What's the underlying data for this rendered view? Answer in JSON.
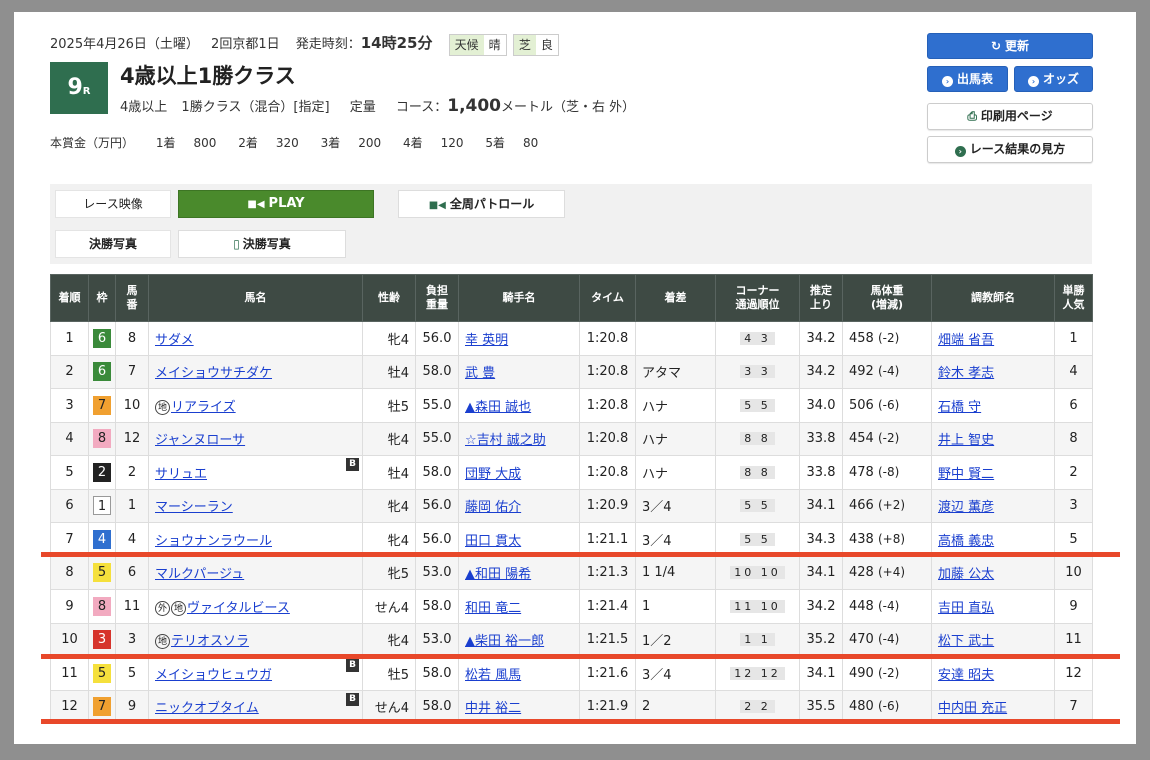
{
  "race": {
    "date": "2025年4月26日（土曜）",
    "meeting": "2回京都1日",
    "start_label": "発走時刻：",
    "start_time": "14時25分",
    "weather_label": "天候",
    "weather": "晴",
    "track_label": "芝",
    "track_cond": "良",
    "number": "9",
    "number_suffix": "R",
    "name": "4歳以上1勝クラス",
    "cond1": "4歳以上",
    "cond2": "1勝クラス（混合）[指定]",
    "cond3": "定量",
    "course_label": "コース：",
    "distance": "1,400",
    "course_detail": "メートル（芝・右 外）",
    "prize_label": "本賞金（万円）",
    "prizes": [
      {
        "place": "1着",
        "amount": "800"
      },
      {
        "place": "2着",
        "amount": "320"
      },
      {
        "place": "3着",
        "amount": "200"
      },
      {
        "place": "4着",
        "amount": "120"
      },
      {
        "place": "5着",
        "amount": "80"
      }
    ]
  },
  "buttons": {
    "update": "更新",
    "entries": "出馬表",
    "odds": "オッズ",
    "print": "印刷用ページ",
    "howto": "レース結果の見方"
  },
  "video": {
    "label": "レース映像",
    "play": "PLAY",
    "patrol": "全周パトロール",
    "photo_label": "決勝写真",
    "photo_btn": "決勝写真"
  },
  "headers": {
    "place": "着順",
    "waku": "枠",
    "num_1": "馬",
    "num_2": "番",
    "horse": "馬名",
    "sexage": "性齢",
    "weight_1": "負担",
    "weight_2": "重量",
    "jockey": "騎手名",
    "time": "タイム",
    "margin": "着差",
    "corner_1": "コーナー",
    "corner_2": "通過順位",
    "last_1": "推定",
    "last_2": "上り",
    "bw_1": "馬体重",
    "bw_2": "(増減)",
    "trainer": "調教師名",
    "pop_1": "単勝",
    "pop_2": "人気"
  },
  "colors": {
    "accent_green": "#2f6e4f",
    "link": "#1a3fcf",
    "button_blue": "#2f6fcf",
    "divider": "#e8482a"
  },
  "rows": [
    {
      "place": "1",
      "waku": "6",
      "num": "8",
      "horse": "サダメ",
      "marks": [],
      "blinker": false,
      "sexage": "牝4",
      "weight": "56.0",
      "jockey": "幸 英明",
      "time": "1:20.8",
      "margin": "",
      "corner": "4 3",
      "last": "34.2",
      "bw": "458",
      "chg": "(-2)",
      "trainer": "畑端 省吾",
      "pop": "1"
    },
    {
      "place": "2",
      "waku": "6",
      "num": "7",
      "horse": "メイショウサチダケ",
      "marks": [],
      "blinker": false,
      "sexage": "牡4",
      "weight": "58.0",
      "jockey": "武 豊",
      "time": "1:20.8",
      "margin": "アタマ",
      "corner": "3 3",
      "last": "34.2",
      "bw": "492",
      "chg": "(-4)",
      "trainer": "鈴木 孝志",
      "pop": "4"
    },
    {
      "place": "3",
      "waku": "7",
      "num": "10",
      "horse": "リアライズ",
      "marks": [
        "地"
      ],
      "blinker": false,
      "sexage": "牡5",
      "weight": "55.0",
      "jockey": "▲森田 誠也",
      "time": "1:20.8",
      "margin": "ハナ",
      "corner": "5 5",
      "last": "34.0",
      "bw": "506",
      "chg": "(-6)",
      "trainer": "石橋 守",
      "pop": "6"
    },
    {
      "place": "4",
      "waku": "8",
      "num": "12",
      "horse": "ジャンヌローサ",
      "marks": [],
      "blinker": false,
      "sexage": "牝4",
      "weight": "55.0",
      "jockey": "☆吉村 誠之助",
      "time": "1:20.8",
      "margin": "ハナ",
      "corner": "8 8",
      "last": "33.8",
      "bw": "454",
      "chg": "(-2)",
      "trainer": "井上 智史",
      "pop": "8"
    },
    {
      "place": "5",
      "waku": "2",
      "num": "2",
      "horse": "サリュエ",
      "marks": [],
      "blinker": true,
      "sexage": "牡4",
      "weight": "58.0",
      "jockey": "団野 大成",
      "time": "1:20.8",
      "margin": "ハナ",
      "corner": "8 8",
      "last": "33.8",
      "bw": "478",
      "chg": "(-8)",
      "trainer": "野中 賢二",
      "pop": "2"
    },
    {
      "place": "6",
      "waku": "1",
      "num": "1",
      "horse": "マーシーラン",
      "marks": [],
      "blinker": false,
      "sexage": "牝4",
      "weight": "56.0",
      "jockey": "藤岡 佑介",
      "time": "1:20.9",
      "margin": "3／4",
      "corner": "5 5",
      "last": "34.1",
      "bw": "466",
      "chg": "(+2)",
      "trainer": "渡辺 薫彦",
      "pop": "3"
    },
    {
      "place": "7",
      "waku": "4",
      "num": "4",
      "horse": "ショウナンラウール",
      "marks": [],
      "blinker": false,
      "sexage": "牝4",
      "weight": "56.0",
      "jockey": "田口 貫太",
      "time": "1:21.1",
      "margin": "3／4",
      "corner": "5 5",
      "last": "34.3",
      "bw": "438",
      "chg": "(+8)",
      "trainer": "高橋 義忠",
      "pop": "5"
    },
    {
      "place": "8",
      "waku": "5",
      "num": "6",
      "horse": "マルクパージュ",
      "marks": [],
      "blinker": false,
      "sexage": "牝5",
      "weight": "53.0",
      "jockey": "▲和田 陽希",
      "time": "1:21.3",
      "margin": "1 1/4",
      "corner": "10 10",
      "last": "34.1",
      "bw": "428",
      "chg": "(+4)",
      "trainer": "加藤 公太",
      "pop": "10"
    },
    {
      "place": "9",
      "waku": "8",
      "num": "11",
      "horse": "ヴァイタルビース",
      "marks": [
        "外",
        "地"
      ],
      "blinker": false,
      "sexage": "せん4",
      "weight": "58.0",
      "jockey": "和田 竜二",
      "time": "1:21.4",
      "margin": "1",
      "corner": "11 10",
      "last": "34.2",
      "bw": "448",
      "chg": "(-4)",
      "trainer": "吉田 直弘",
      "pop": "9"
    },
    {
      "place": "10",
      "waku": "3",
      "num": "3",
      "horse": "テリオスソラ",
      "marks": [
        "地"
      ],
      "blinker": false,
      "sexage": "牝4",
      "weight": "53.0",
      "jockey": "▲柴田 裕一郎",
      "time": "1:21.5",
      "margin": "1／2",
      "corner": "1 1",
      "last": "35.2",
      "bw": "470",
      "chg": "(-4)",
      "trainer": "松下 武士",
      "pop": "11"
    },
    {
      "place": "11",
      "waku": "5",
      "num": "5",
      "horse": "メイショウヒュウガ",
      "marks": [],
      "blinker": true,
      "sexage": "牡5",
      "weight": "58.0",
      "jockey": "松若 風馬",
      "time": "1:21.6",
      "margin": "3／4",
      "corner": "12 12",
      "last": "34.1",
      "bw": "490",
      "chg": "(-2)",
      "trainer": "安達 昭夫",
      "pop": "12"
    },
    {
      "place": "12",
      "waku": "7",
      "num": "9",
      "horse": "ニックオブタイム",
      "marks": [],
      "blinker": true,
      "sexage": "せん4",
      "weight": "58.0",
      "jockey": "中井 裕二",
      "time": "1:21.9",
      "margin": "2",
      "corner": "2 2",
      "last": "35.5",
      "bw": "480",
      "chg": "(-6)",
      "trainer": "中内田 充正",
      "pop": "7"
    }
  ],
  "blinker_label": "B"
}
